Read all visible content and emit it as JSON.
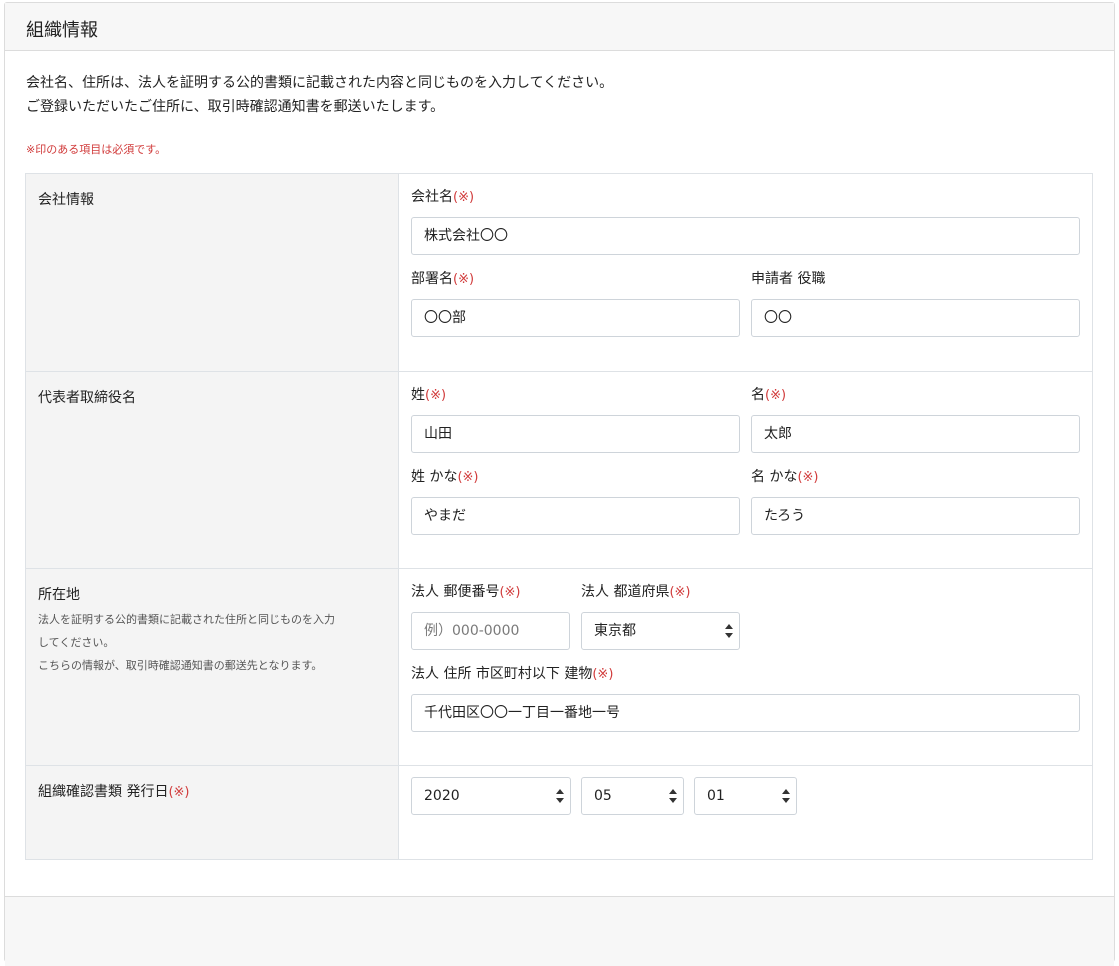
{
  "header": {
    "title": "組織情報"
  },
  "intro": {
    "line1": "会社名、住所は、法人を証明する公的書類に記載された内容と同じものを入力してください。",
    "line2": "ご登録いただいたご住所に、取引時確認通知書を郵送いたします。",
    "required_note": "※印のある項目は必須です。"
  },
  "required_mark": "(※)",
  "company": {
    "section_label": "会社情報",
    "name_label": "会社名",
    "name_value": "株式会社〇〇",
    "dept_label": "部署名",
    "dept_value": "〇〇部",
    "title_label": "申請者 役職",
    "title_value": "〇〇"
  },
  "representative": {
    "section_label": "代表者取締役名",
    "last_label": "姓",
    "last_value": "山田",
    "first_label": "名",
    "first_value": "太郎",
    "last_kana_label": "姓 かな",
    "last_kana_value": "やまだ",
    "first_kana_label": "名 かな",
    "first_kana_value": "たろう"
  },
  "address": {
    "section_label": "所在地",
    "section_note1": "法人を証明する公的書類に記載された住所と同じものを入力",
    "section_note2": "してください。",
    "section_note3": "こちらの情報が、取引時確認通知書の郵送先となります。",
    "postal_label": "法人 郵便番号",
    "postal_placeholder": "例）000-0000",
    "pref_label": "法人 都道府県",
    "pref_value": "東京都",
    "street_label": "法人 住所 市区町村以下 建物",
    "street_value": "千代田区〇〇一丁目一番地一号"
  },
  "issue_date": {
    "section_label": "組織確認書類 発行日",
    "year": "2020",
    "month": "05",
    "day": "01"
  }
}
